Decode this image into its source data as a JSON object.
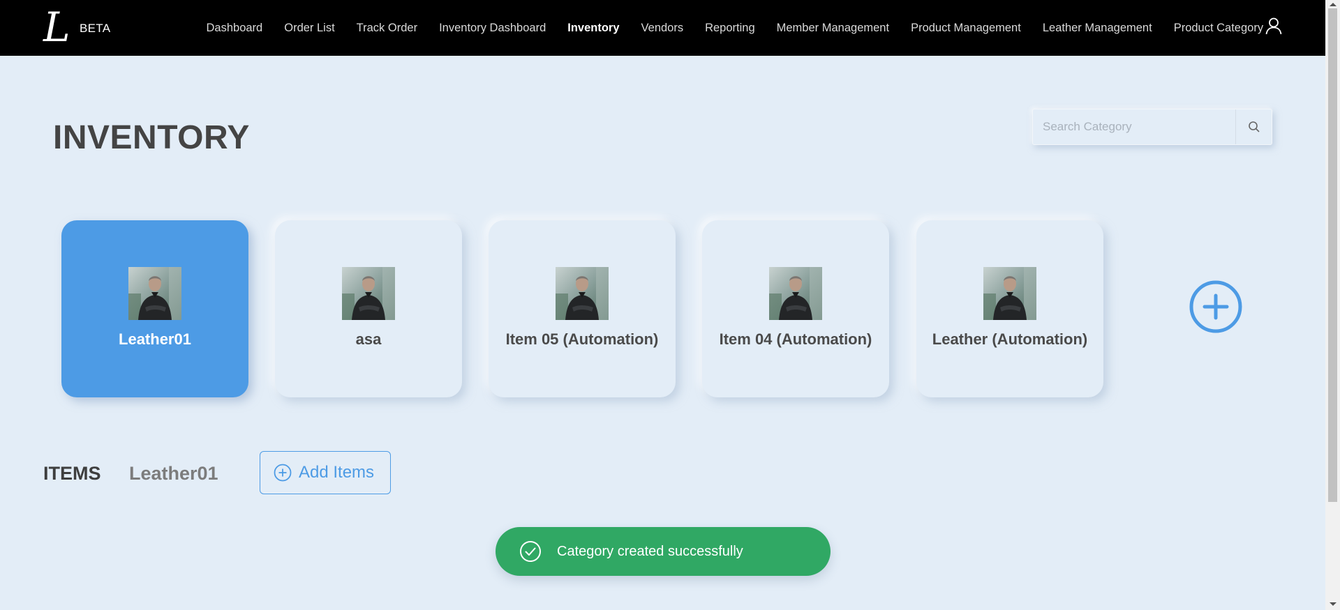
{
  "brand": {
    "logo_letter": "L",
    "badge": "BETA"
  },
  "nav": {
    "items": [
      {
        "label": "Dashboard",
        "active": false
      },
      {
        "label": "Order List",
        "active": false
      },
      {
        "label": "Track Order",
        "active": false
      },
      {
        "label": "Inventory Dashboard",
        "active": false
      },
      {
        "label": "Inventory",
        "active": true
      },
      {
        "label": "Vendors",
        "active": false
      },
      {
        "label": "Reporting",
        "active": false
      },
      {
        "label": "Member Management",
        "active": false
      },
      {
        "label": "Product Management",
        "active": false
      },
      {
        "label": "Leather Management",
        "active": false
      },
      {
        "label": "Product Category",
        "active": false
      }
    ],
    "user_icon": "user-icon"
  },
  "page": {
    "title": "INVENTORY"
  },
  "search": {
    "placeholder": "Search Category",
    "value": "",
    "icon": "search-icon"
  },
  "categories": [
    {
      "label": "Leather01",
      "selected": true
    },
    {
      "label": "asa",
      "selected": false
    },
    {
      "label": "Item 05 (Automation)",
      "selected": false
    },
    {
      "label": "Item 04 (Automation)",
      "selected": false
    },
    {
      "label": "Leather (Automation)",
      "selected": false
    }
  ],
  "add_category_icon": "plus-circle-icon",
  "items_section": {
    "title": "ITEMS",
    "selected_category": "Leather01",
    "add_button_label": "Add Items"
  },
  "toast": {
    "message": "Category created successfully",
    "icon": "check-circle-icon"
  },
  "colors": {
    "accent": "#4d9be5",
    "background": "#e3edf7",
    "nav_bg": "#000000",
    "success": "#30a864"
  }
}
